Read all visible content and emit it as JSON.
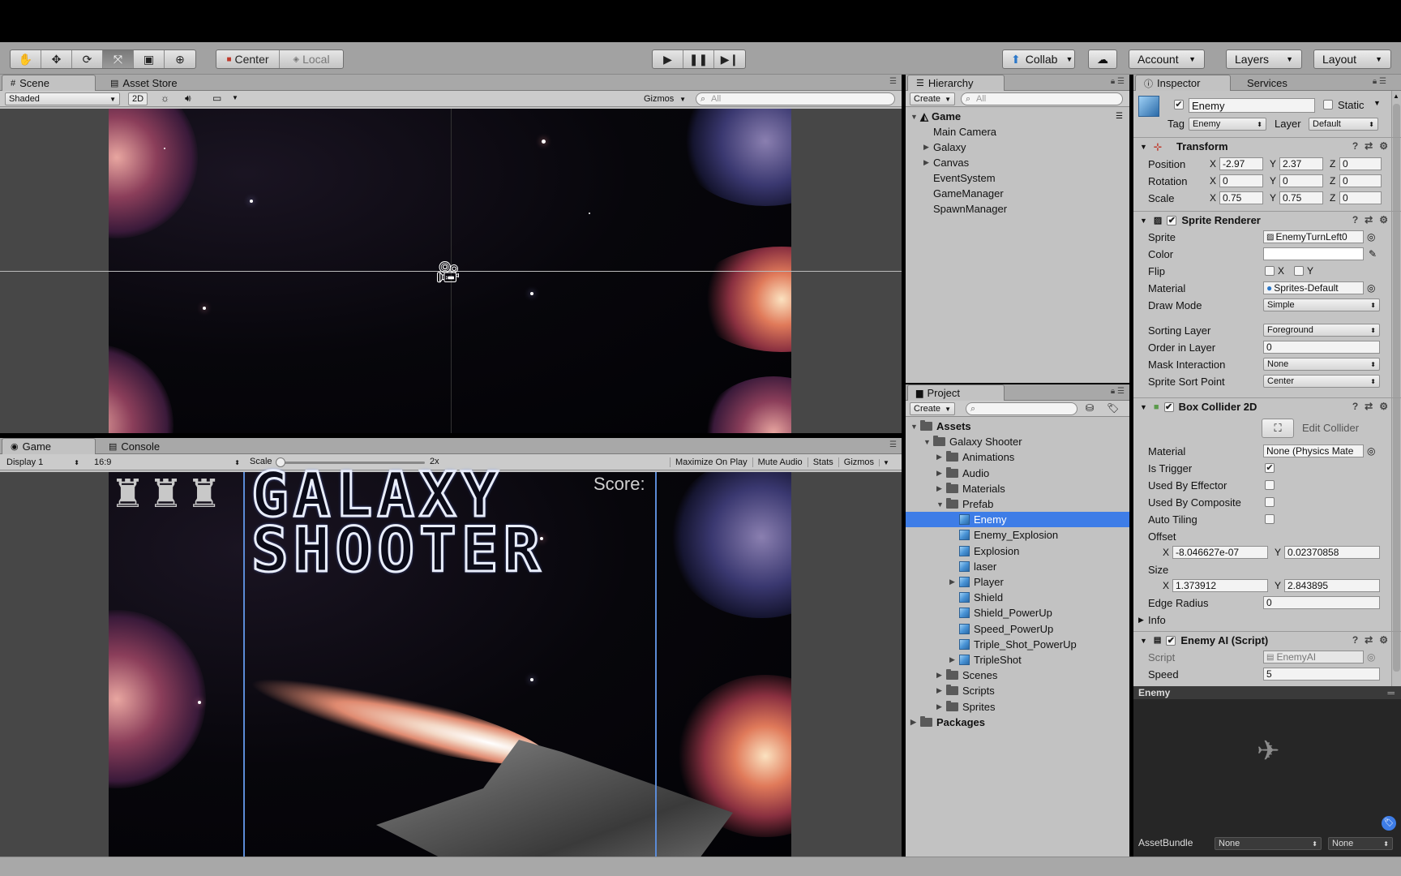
{
  "toolbar": {
    "tools": [
      "hand-tool-icon",
      "move-tool-icon",
      "rotate-tool-icon",
      "scale-tool-icon",
      "rect-tool-icon",
      "transform-tool-icon"
    ],
    "pivot": "Center",
    "space": "Local",
    "collab": "Collab",
    "account": "Account",
    "layers": "Layers",
    "layout": "Layout"
  },
  "scene": {
    "tabs": [
      "Scene",
      "Asset Store"
    ],
    "shading": "Shaded",
    "mode2d": "2D",
    "gizmos": "Gizmos",
    "search_placeholder": "All"
  },
  "game": {
    "tabs": [
      "Game",
      "Console"
    ],
    "display": "Display 1",
    "aspect": "16:9",
    "scale_label": "Scale",
    "scale_value": "2x",
    "scale_fraction": 0.0,
    "buttons": [
      "Maximize On Play",
      "Mute Audio",
      "Stats",
      "Gizmos"
    ],
    "title_line1": "GALAXY",
    "title_line2": "SHOOTER",
    "score": "Score:"
  },
  "hierarchy": {
    "tab": "Hierarchy",
    "create": "Create",
    "search_placeholder": "All",
    "scene_name": "Game",
    "items": [
      {
        "label": "Main Camera",
        "expandable": false
      },
      {
        "label": "Galaxy",
        "expandable": true
      },
      {
        "label": "Canvas",
        "expandable": true
      },
      {
        "label": "EventSystem",
        "expandable": false
      },
      {
        "label": "GameManager",
        "expandable": false
      },
      {
        "label": "SpawnManager",
        "expandable": false
      }
    ]
  },
  "project": {
    "tab": "Project",
    "create": "Create",
    "root": "Assets",
    "game_folder": "Galaxy Shooter",
    "folders_top": [
      "Animations",
      "Audio",
      "Materials"
    ],
    "prefab_folder": "Prefab",
    "prefabs": [
      {
        "label": "Enemy",
        "selected": true,
        "expandable": false
      },
      {
        "label": "Enemy_Explosion",
        "expandable": false
      },
      {
        "label": "Explosion",
        "expandable": false
      },
      {
        "label": "laser",
        "expandable": false
      },
      {
        "label": "Player",
        "expandable": true
      },
      {
        "label": "Shield",
        "expandable": false
      },
      {
        "label": "Shield_PowerUp",
        "expandable": false
      },
      {
        "label": "Speed_PowerUp",
        "expandable": false
      },
      {
        "label": "Triple_Shot_PowerUp",
        "expandable": false
      },
      {
        "label": "TripleShot",
        "expandable": true
      }
    ],
    "folders_bottom": [
      "Scenes",
      "Scripts",
      "Sprites"
    ],
    "packages": "Packages"
  },
  "inspector": {
    "tabs": [
      "Inspector",
      "Services"
    ],
    "object_name": "Enemy",
    "static_label": "Static",
    "tag_label": "Tag",
    "tag_value": "Enemy",
    "layer_label": "Layer",
    "layer_value": "Default",
    "transform": {
      "title": "Transform",
      "position": {
        "label": "Position",
        "x": "-2.97",
        "y": "2.37",
        "z": "0"
      },
      "rotation": {
        "label": "Rotation",
        "x": "0",
        "y": "0",
        "z": "0"
      },
      "scale": {
        "label": "Scale",
        "x": "0.75",
        "y": "0.75",
        "z": "0"
      }
    },
    "sprite_renderer": {
      "title": "Sprite Renderer",
      "sprite_label": "Sprite",
      "sprite_value": "EnemyTurnLeft0",
      "color_label": "Color",
      "flip_label": "Flip",
      "flip_x": "X",
      "flip_y": "Y",
      "material_label": "Material",
      "material_value": "Sprites-Default",
      "draw_mode_label": "Draw Mode",
      "draw_mode_value": "Simple",
      "sorting_layer_label": "Sorting Layer",
      "sorting_layer_value": "Foreground",
      "order_label": "Order in Layer",
      "order_value": "0",
      "mask_label": "Mask Interaction",
      "mask_value": "None",
      "sort_point_label": "Sprite Sort Point",
      "sort_point_value": "Center"
    },
    "box_collider": {
      "title": "Box Collider 2D",
      "edit_collider": "Edit Collider",
      "material_label": "Material",
      "material_value": "None (Physics Mate",
      "trigger_label": "Is Trigger",
      "effector_label": "Used By Effector",
      "composite_label": "Used By Composite",
      "tiling_label": "Auto Tiling",
      "offset_label": "Offset",
      "offset_x": "-8.046627e-07",
      "offset_y": "0.02370858",
      "size_label": "Size",
      "size_x": "1.373912",
      "size_y": "2.843895",
      "edge_label": "Edge Radius",
      "edge_value": "0",
      "info_label": "Info"
    },
    "enemy_ai": {
      "title": "Enemy AI (Script)",
      "script_label": "Script",
      "script_value": "EnemyAI",
      "speed_label": "Speed",
      "speed_value": "5"
    },
    "preview_title": "Enemy",
    "assetbundle_label": "AssetBundle",
    "assetbundle_value": "None",
    "assetbundle_variant": "None"
  },
  "colors": {
    "selection": "#3e7de7",
    "panel": "#c2c2c2",
    "toolbar": "#a2a2a2"
  }
}
